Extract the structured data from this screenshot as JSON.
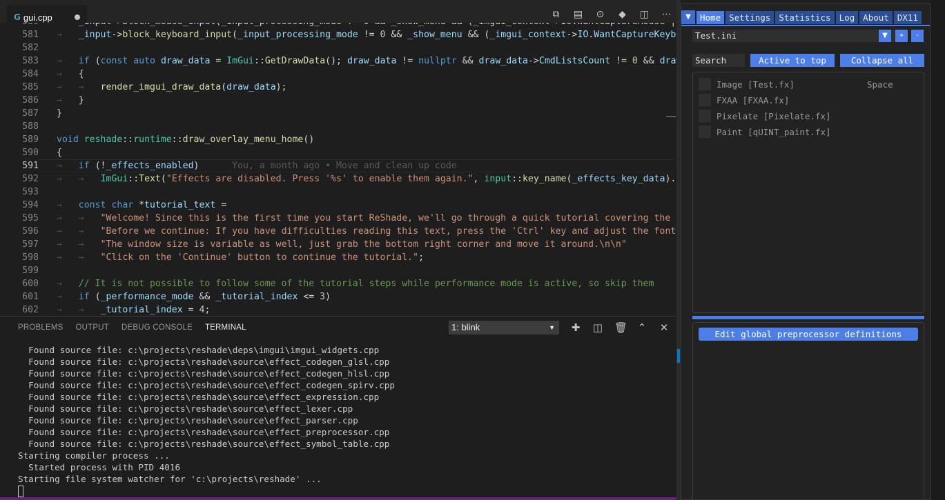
{
  "editor": {
    "tab_title": "gui.cpp",
    "tab_icon": "C++",
    "blame": "You, a month ago • Move and clean up code",
    "lines": [
      {
        "n": "580",
        "html": "<span class=\"ar\">→</span>   _input->block_mouse_input(_input_processing_mode != 0 && _show_menu && (_imgui_context->IO.WantCaptureMouse || _"
      },
      {
        "n": "581",
        "html": "<span class=\"ar\">→</span>   <span class=\"var\">_input</span>-><span class=\"fn\">block_keyboard_input</span>(<span class=\"var\">_input_processing_mode</span> != <span style=\"color:#b5cea8\">0</span> && <span class=\"var\">_show_menu</span> && (<span class=\"var\">_imgui_context</span>-><span class=\"var\">IO</span>.<span class=\"var\">WantCaptureKeyboard</span>"
      },
      {
        "n": "582",
        "html": ""
      },
      {
        "n": "583",
        "html": "<span class=\"ar\">→</span>   <span class=\"kw\">if</span> (<span class=\"kw\">const</span> <span class=\"kw\">auto</span> <span class=\"var\">draw_data</span> = <span class=\"ty\">ImGui</span>::<span class=\"fn\">GetDrawData</span>(); <span class=\"var\">draw_data</span> != <span class=\"kw\">nullptr</span> && <span class=\"var\">draw_data</span>-><span class=\"var\">CmdListsCount</span> != <span style=\"color:#b5cea8\">0</span> && <span class=\"var\">draw_da</span>"
      },
      {
        "n": "584",
        "html": "<span class=\"ar\">→</span>   {"
      },
      {
        "n": "585",
        "html": "<span class=\"ar\">→</span>   <span class=\"ar\">→</span>   <span class=\"fn\">render_imgui_draw_data</span>(<span class=\"var\">draw_data</span>);"
      },
      {
        "n": "586",
        "html": "<span class=\"ar\">→</span>   }"
      },
      {
        "n": "587",
        "html": "}"
      },
      {
        "n": "588",
        "html": ""
      },
      {
        "n": "589",
        "html": "<span class=\"kw\">void</span> <span class=\"ty\">reshade</span>::<span class=\"ty\">runtime</span>::<span class=\"fn\">draw_overlay_menu_home</span>()"
      },
      {
        "n": "590",
        "html": "{"
      },
      {
        "n": "591",
        "html": "<span class=\"ar\">→</span>   <span class=\"kw\">if</span> (!<span class=\"var\">_effects_enabled</span>)      <span class=\"blame\">You, a month ago • Move and clean up code</span>"
      },
      {
        "n": "592",
        "html": "<span class=\"ar\">→</span>   <span class=\"ar\">→</span>   <span class=\"ty\">ImGui</span>::<span class=\"fn\">Text</span>(<span class=\"str\">\"Effects are disabled. Press '%s' to enable them again.\"</span>, <span class=\"ty\">input</span>::<span class=\"fn\">key_name</span>(<span class=\"var\">_effects_key_data</span>).<span class=\"fn\">c_st</span>"
      },
      {
        "n": "593",
        "html": ""
      },
      {
        "n": "594",
        "html": "<span class=\"ar\">→</span>   <span class=\"kw\">const</span> <span class=\"kw\">char</span> *<span class=\"var\">tutorial_text</span> ="
      },
      {
        "n": "595",
        "html": "<span class=\"ar\">→</span>   <span class=\"ar\">→</span>   <span class=\"str\">\"Welcome! Since this is the first time you start ReShade, we'll go through a quick tutorial covering the most</span>"
      },
      {
        "n": "596",
        "html": "<span class=\"ar\">→</span>   <span class=\"ar\">→</span>   <span class=\"str\">\"Before we continue: If you have difficulties reading this text, press the 'Ctrl' key and adjust the font size</span>"
      },
      {
        "n": "597",
        "html": "<span class=\"ar\">→</span>   <span class=\"ar\">→</span>   <span class=\"str\">\"The window size is variable as well, just grab the bottom right corner and move it around.\\n\\n\"</span>"
      },
      {
        "n": "598",
        "html": "<span class=\"ar\">→</span>   <span class=\"ar\">→</span>   <span class=\"str\">\"Click on the 'Continue' button to continue the tutorial.\"</span>;"
      },
      {
        "n": "599",
        "html": ""
      },
      {
        "n": "600",
        "html": "<span class=\"ar\">→</span>   <span class=\"cm\">// It is not possible to follow some of the tutorial steps while performance mode is active, so skip them</span>"
      },
      {
        "n": "601",
        "html": "<span class=\"ar\">→</span>   <span class=\"kw\">if</span> (<span class=\"var\">_performance_mode</span> && <span class=\"var\">_tutorial_index</span> <= <span style=\"color:#b5cea8\">3</span>)"
      },
      {
        "n": "602",
        "html": "<span class=\"ar\">→</span>   <span class=\"ar\">→</span>   <span class=\"var\">_tutorial_index</span> = <span style=\"color:#b5cea8\">4</span>;"
      }
    ],
    "current_line": "591"
  },
  "panel": {
    "tabs": [
      "PROBLEMS",
      "OUTPUT",
      "DEBUG CONSOLE",
      "TERMINAL"
    ],
    "active_tab": "TERMINAL",
    "terminal_select": "1: blink",
    "terminal_lines": [
      "  Found source file: c:\\projects\\reshade\\deps\\imgui\\imgui_widgets.cpp",
      "  Found source file: c:\\projects\\reshade\\source\\effect_codegen_glsl.cpp",
      "  Found source file: c:\\projects\\reshade\\source\\effect_codegen_hlsl.cpp",
      "  Found source file: c:\\projects\\reshade\\source\\effect_codegen_spirv.cpp",
      "  Found source file: c:\\projects\\reshade\\source\\effect_expression.cpp",
      "  Found source file: c:\\projects\\reshade\\source\\effect_lexer.cpp",
      "  Found source file: c:\\projects\\reshade\\source\\effect_parser.cpp",
      "  Found source file: c:\\projects\\reshade\\source\\effect_preprocessor.cpp",
      "  Found source file: c:\\projects\\reshade\\source\\effect_symbol_table.cpp",
      "Starting compiler process ...",
      "  Started process with PID 4016",
      "Starting file system watcher for 'c:\\projects\\reshade' ..."
    ]
  },
  "reshade": {
    "menu": [
      "Home",
      "Settings",
      "Statistics",
      "Log",
      "About",
      "DX11"
    ],
    "active_menu": "Home",
    "preset": "Test.ini",
    "combo_arrow": "▼",
    "add_label": "+",
    "remove_label": "-",
    "search_placeholder": "Search",
    "active_to_top": "Active to top",
    "collapse_all": "Collapse all",
    "effects": [
      {
        "label": "Image [Test.fx]",
        "checked": false
      },
      {
        "label": "FXAA [FXAA.fx]",
        "checked": false
      },
      {
        "label": "Pixelate [Pixelate.fx]",
        "checked": false
      },
      {
        "label": "Paint [qUINT_paint.fx]",
        "checked": false
      }
    ],
    "space_key": "Space",
    "edit_defs": "Edit global preprocessor definitions"
  }
}
